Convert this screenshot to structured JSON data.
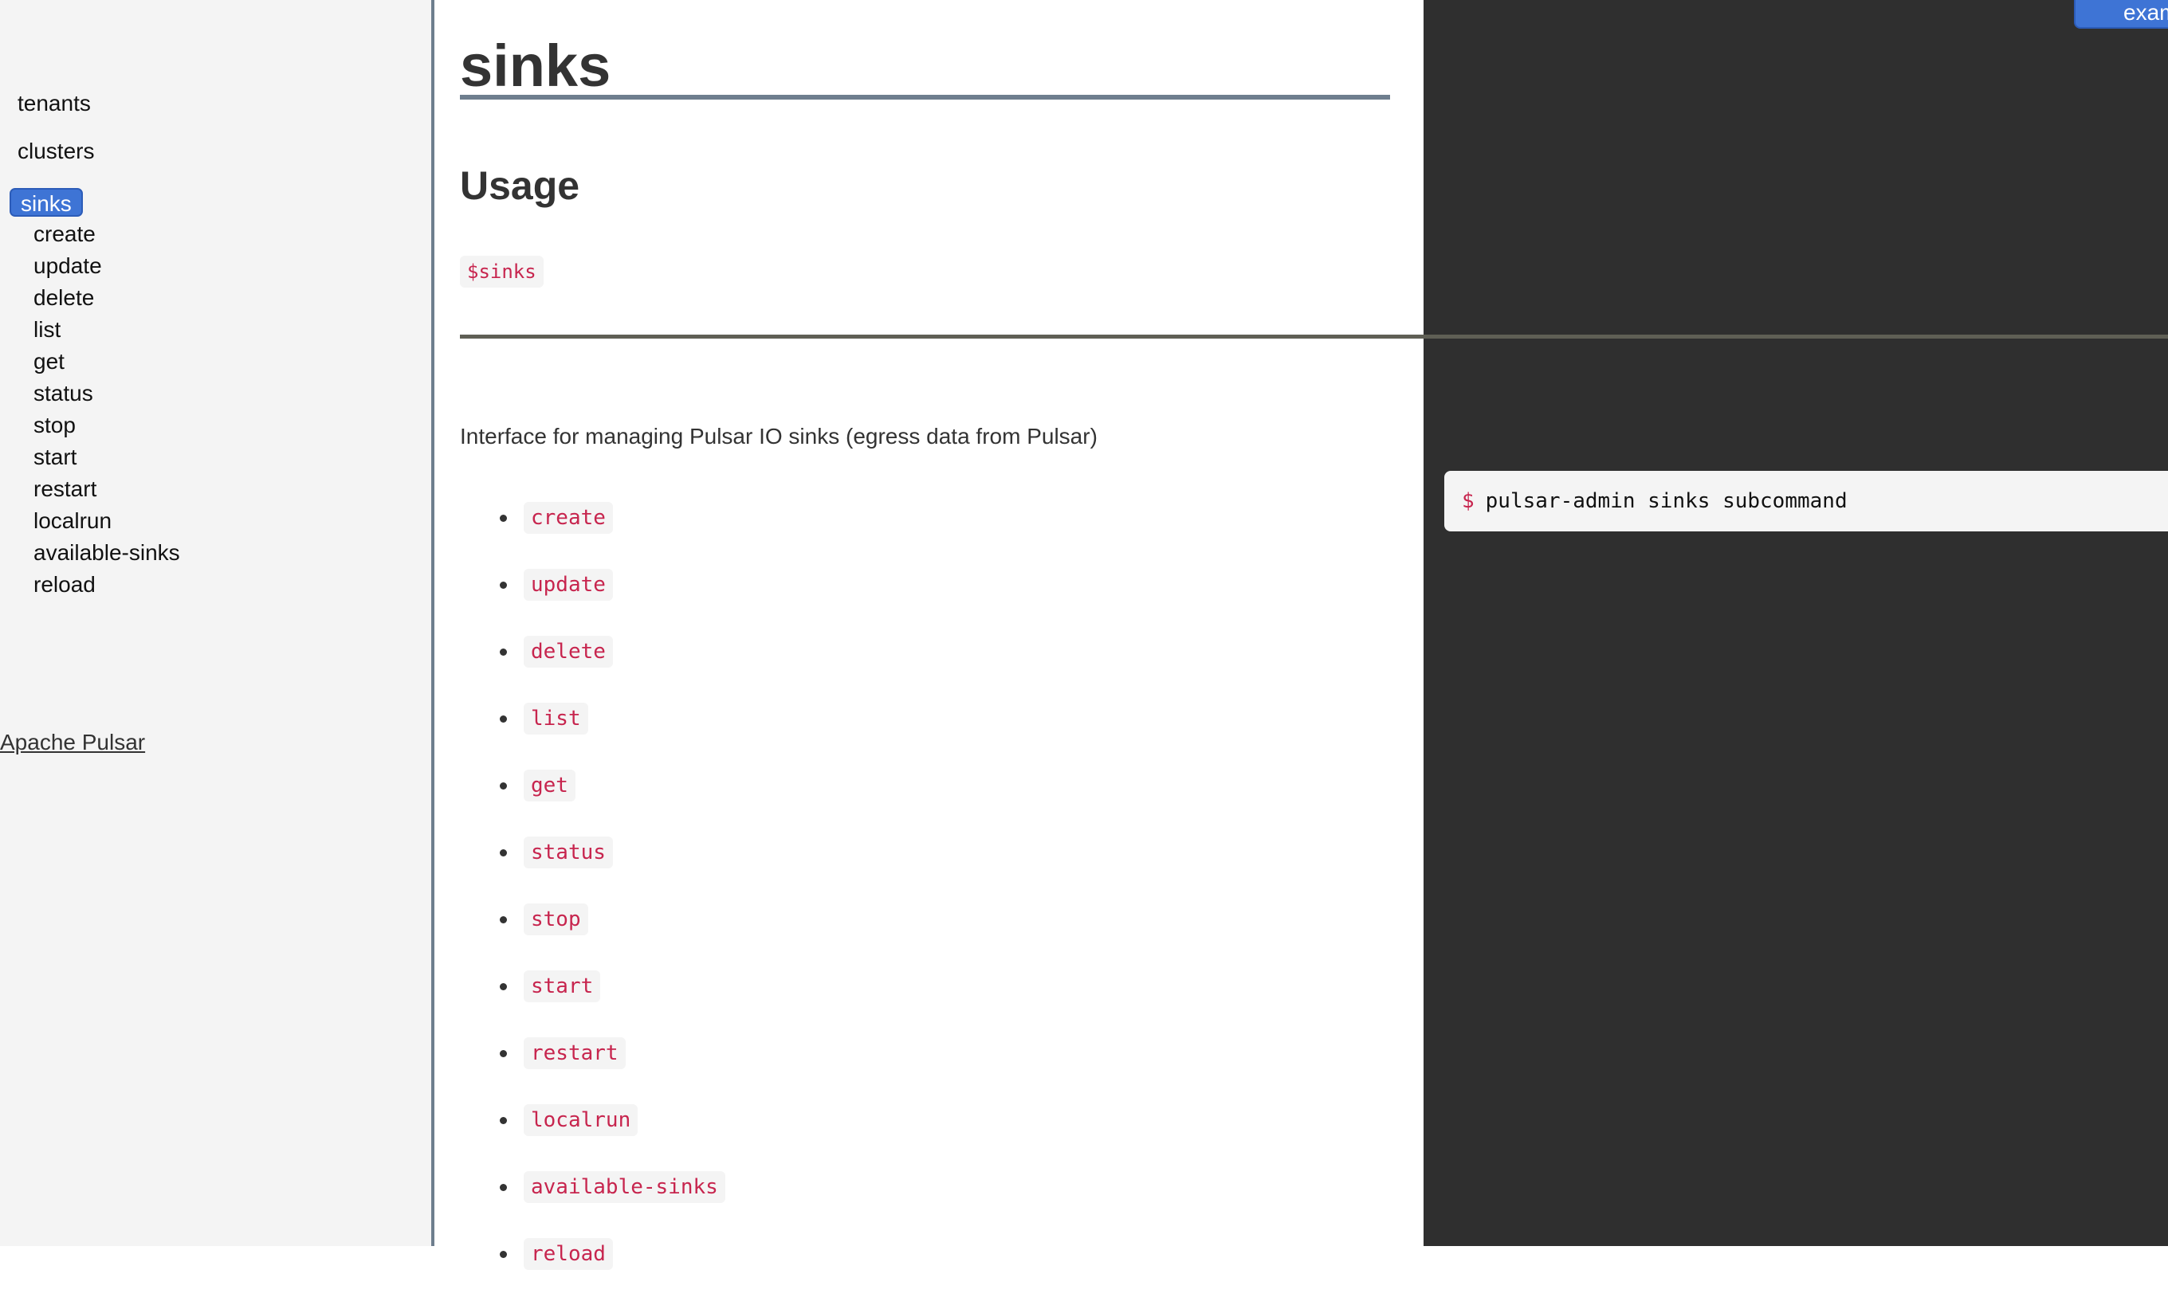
{
  "sidebar": {
    "top_items": [
      "tenants",
      "clusters"
    ],
    "active_item": "sinks",
    "sub_items": [
      "create",
      "update",
      "delete",
      "list",
      "get",
      "status",
      "stop",
      "start",
      "restart",
      "localrun",
      "available-sinks",
      "reload"
    ],
    "footer_link": "Apache Pulsar"
  },
  "main": {
    "title": "sinks",
    "usage_heading": "Usage",
    "usage_code": "$sinks",
    "description": "Interface for managing Pulsar IO sinks (egress data from Pulsar)",
    "commands": [
      "create",
      "update",
      "delete",
      "list",
      "get",
      "status",
      "stop",
      "start",
      "restart",
      "localrun",
      "available-sinks",
      "reload"
    ]
  },
  "examples": {
    "tab_label": "example",
    "prompt": "$",
    "command": "pulsar-admin sinks subcommand"
  },
  "colors": {
    "accent": "#3e74d5",
    "code_text": "#c7254e",
    "panel_dark": "#2f2f2f",
    "sidebar_bg": "#f4f4f4"
  }
}
